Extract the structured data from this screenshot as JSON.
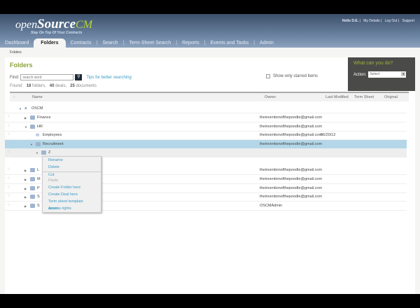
{
  "app": {
    "logo_main": "openSourceCM",
    "logo_open": "open",
    "logo_source": "Source",
    "logo_cm": "CM",
    "tagline": "Stay On Top Of Your Contracts"
  },
  "toplinks": [
    "Hello D.E.",
    "My Details",
    "Log Out",
    "Support"
  ],
  "nav": [
    "Dashboard",
    "Folders",
    "Contracts",
    "Search",
    "Term Sheet Search",
    "Reports",
    "Events and Tasks",
    "Admin"
  ],
  "breadcrumb": "Folders",
  "title": "Folders",
  "find": {
    "label": "Find:",
    "placeholder": "search word",
    "tips": "Tips for better searching"
  },
  "found": {
    "label": "Found:",
    "folders": "18",
    "folders_label": "folders,",
    "deals": "40",
    "deals_label": "deals,",
    "docs": "25",
    "docs_label": "documents"
  },
  "starred": "Show only starred items",
  "action": {
    "question": "What can you do?",
    "label": "Action:",
    "select": "Select"
  },
  "columns": {
    "name": "Name",
    "owner": "Owner",
    "modified": "Last Modified",
    "term": "Term Sheet",
    "original": "Original"
  },
  "rows": [
    {
      "name": "OSCM",
      "owner": "",
      "date": ""
    },
    {
      "name": "Finance",
      "owner": "theinventionofthepoodle@gmail.com",
      "date": ""
    },
    {
      "name": "HR",
      "owner": "theinventionofthepoodle@gmail.com",
      "date": ""
    },
    {
      "name": "Employees",
      "owner": "theinventionofthepoodle@gmail.com",
      "date": "06/20/12"
    },
    {
      "name": "Recruitment",
      "owner": "theinventionofthepoodle@gmail.com",
      "date": ""
    },
    {
      "name": "Z",
      "owner": "",
      "date": ""
    },
    {
      "name": "L",
      "owner": "theinventionofthepoodle@gmail.com",
      "date": ""
    },
    {
      "name": "M",
      "owner": "theinventionofthepoodle@gmail.com",
      "date": ""
    },
    {
      "name": "P",
      "owner": "theinventionofthepoodle@gmail.com",
      "date": ""
    },
    {
      "name": "S",
      "owner": "theinventionofthepoodle@gmail.com",
      "date": ""
    },
    {
      "name": "S",
      "owner": "OSCMAdmin",
      "date": ""
    }
  ],
  "context_menu": [
    "Rename",
    "Delete",
    "Cut",
    "Paste",
    "Create Folder here",
    "Create Deal here",
    "Term sheet template assoc.",
    "Access rights"
  ]
}
